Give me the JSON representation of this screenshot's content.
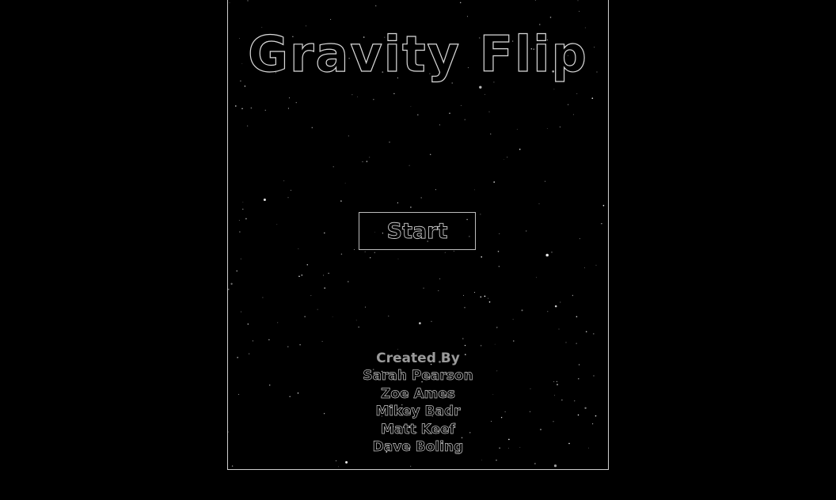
{
  "game": {
    "title": "Gravity Flip",
    "start_label": "Start",
    "credits": {
      "heading": "Created By",
      "names": [
        "Sarah Pearson",
        "Zoe Ames",
        "Mikey Badr",
        "Matt Keef",
        "Dave Boling"
      ]
    }
  },
  "colors": {
    "background": "#000000",
    "frame_border": "#cfcfcf",
    "outline_text": "#d8d8d8",
    "credits_heading": "#9a9a9a"
  }
}
